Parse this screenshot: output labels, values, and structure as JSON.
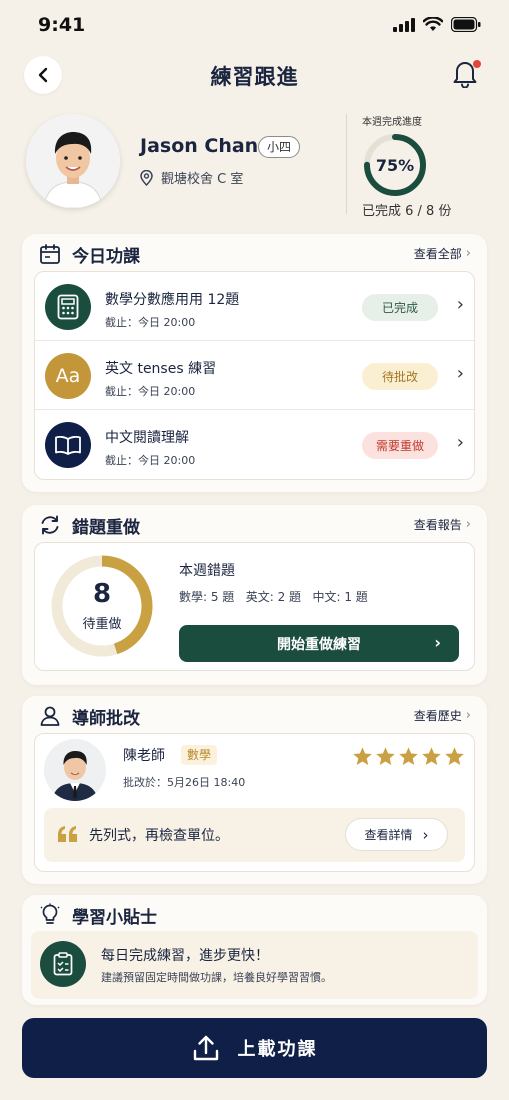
{
  "status_bar": {
    "time": "9:41"
  },
  "nav": {
    "title": "練習跟進"
  },
  "profile": {
    "name": "Jason Chan",
    "grade": "小四",
    "location": "觀塘校舍 C 室",
    "progress_label": "本週完成進度",
    "progress_percent": "75%",
    "progress_fraction": 0.75,
    "progress_count": "已完成 6 / 8 份"
  },
  "today": {
    "title": "今日功課",
    "link": "查看全部",
    "tasks": [
      {
        "title": "數學分數應用用 12題",
        "due": "截止：今日 20:00",
        "status": "已完成",
        "icon": "calculator-icon",
        "icon_bg": "#1b4d3e",
        "status_bg": "#e6efe8",
        "status_color": "#2f5a45"
      },
      {
        "title": "英文 tenses 練習",
        "due": "截止：今日 20:00",
        "status": "待批改",
        "icon": "Aa",
        "icon_bg": "#c4963a",
        "status_bg": "#fbefd2",
        "status_color": "#a47724"
      },
      {
        "title": "中文閱讀理解",
        "due": "截止：今日 20:00",
        "status": "需要重做",
        "icon": "book-icon",
        "icon_bg": "#0f1f47",
        "status_bg": "#fbe2df",
        "status_color": "#c0392b"
      }
    ]
  },
  "mistakes": {
    "title": "錯題重做",
    "link": "查看報告",
    "count": "8",
    "count_label": "待重做",
    "ring_fraction": 0.45,
    "week_title": "本週錯題",
    "breakdown": "數學: 5 題   英文: 2 題   中文: 1 題",
    "button": "開始重做練習"
  },
  "tutor": {
    "title": "導師批改",
    "link": "查看歷史",
    "name": "陳老師",
    "subject": "數學",
    "date": "批改於：5月26日 18:40",
    "rating": 5,
    "comment": "先列式，再檢查單位。",
    "detail_button": "查看詳情"
  },
  "tips": {
    "title": "學習小貼士",
    "headline": "每日完成練習，進步更快！",
    "body": "建議預留固定時間做功課，培養良好學習習慣。"
  },
  "upload": {
    "label": "上載功課"
  },
  "colors": {
    "green": "#1b4d3e",
    "navy": "#0f1f47",
    "gold": "#c4963a",
    "star": "#c9a042"
  }
}
